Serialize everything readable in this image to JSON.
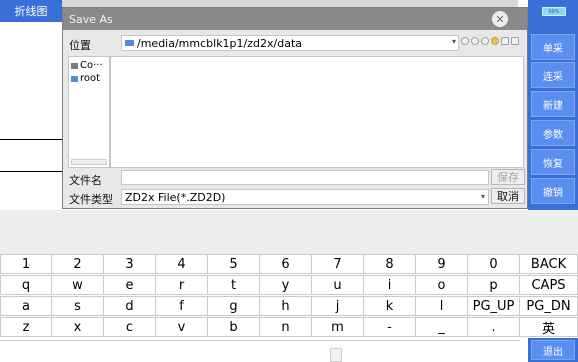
{
  "top_tab": {
    "label": "折线图"
  },
  "battery": {
    "label": "99%"
  },
  "sidebar": {
    "buttons": [
      "单采",
      "连采",
      "新建",
      "参数",
      "恢复",
      "撤销"
    ],
    "exit": "退出"
  },
  "dialog": {
    "title": "Save As",
    "location_label": "位置",
    "location_path": "/media/mmcblk1p1/zd2x/data",
    "places": [
      "Co···",
      "root"
    ],
    "filename_label": "文件名",
    "filename_value": "",
    "save_button": "保存",
    "filetype_label": "文件类型",
    "filetype_value": "ZD2x File(*.ZD2D)",
    "cancel_button": "取消"
  },
  "keyboard": {
    "rows": [
      [
        "1",
        "2",
        "3",
        "4",
        "5",
        "6",
        "7",
        "8",
        "9",
        "0",
        "BACK"
      ],
      [
        "q",
        "w",
        "e",
        "r",
        "t",
        "y",
        "u",
        "i",
        "o",
        "p",
        "CAPS"
      ],
      [
        "a",
        "s",
        "d",
        "f",
        "g",
        "h",
        "j",
        "k",
        "l",
        "PG_UP",
        "PG_DN"
      ],
      [
        "z",
        "x",
        "c",
        "v",
        "b",
        "n",
        "m",
        "-",
        "_",
        ".",
        "英"
      ]
    ]
  },
  "colors": {
    "accent_blue": "#3a6fd8",
    "button_blue": "#5a8ff0",
    "titlebar_grey": "#8a8a8a"
  }
}
